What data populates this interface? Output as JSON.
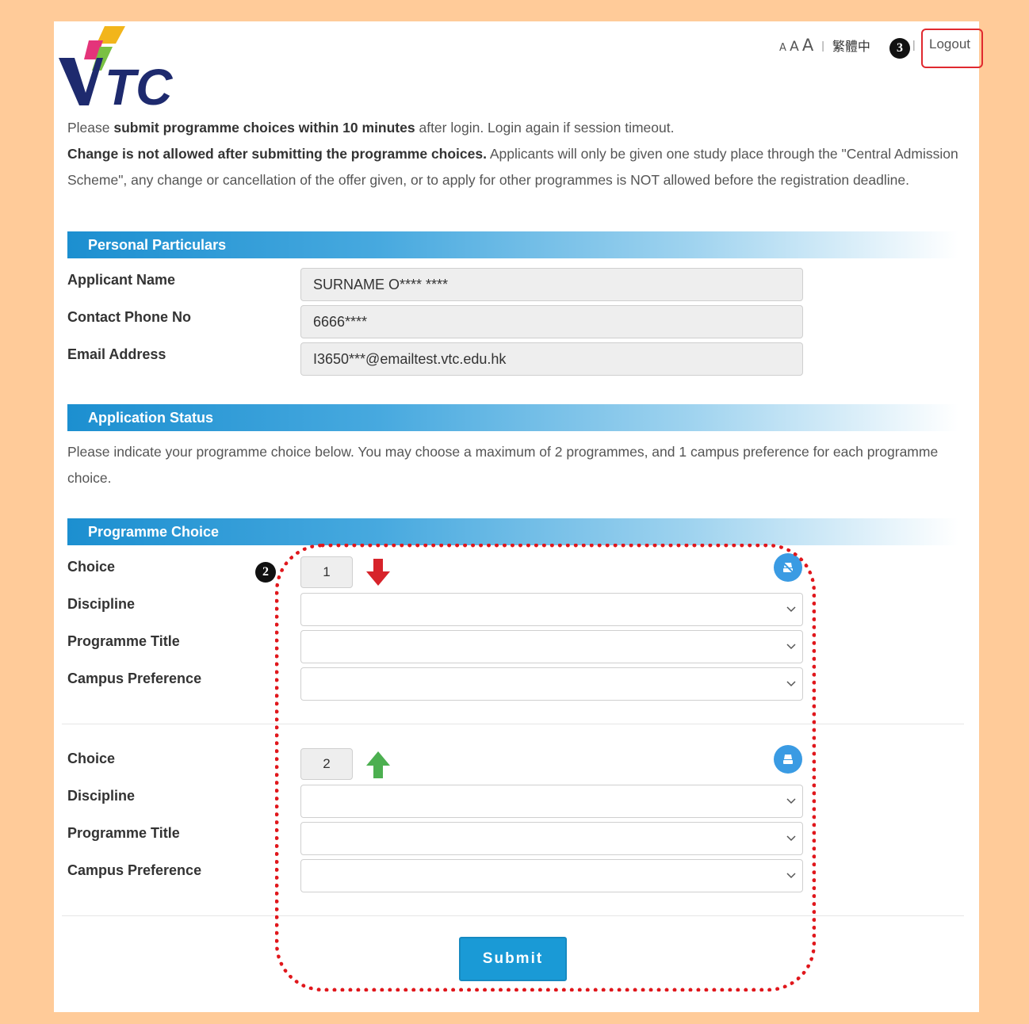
{
  "header": {
    "logo_alt": "VTC",
    "font_size_labels": [
      "A",
      "A",
      "A"
    ],
    "language_label": "繁體中",
    "logout_label": "Logout",
    "markers": {
      "logout": "3",
      "programme_area": "2"
    }
  },
  "intro": {
    "line1_prefix": "Please ",
    "line1_bold": "submit programme choices within 10 minutes",
    "line1_suffix": " after login. Login again if session timeout.",
    "line2_bold": "Change is not allowed after submitting the programme choices.",
    "line2_rest": " Applicants will only be given one study place through the \"Central Admission Scheme\", any change or cancellation of the offer given, or to apply for other programmes is NOT allowed before the registration deadline."
  },
  "personal": {
    "title": "Personal Particulars",
    "fields": [
      {
        "label": "Applicant Name",
        "value": "SURNAME O**** ****"
      },
      {
        "label": "Contact Phone No",
        "value": "6666****"
      },
      {
        "label": "Email Address",
        "value": "I3650***@emailtest.vtc.edu.hk"
      }
    ]
  },
  "status": {
    "title": "Application Status",
    "text": "Please indicate your programme choice below. You may choose a maximum of 2 programmes, and 1 campus preference for each programme choice."
  },
  "programme": {
    "title": "Programme Choice",
    "choices": [
      {
        "choice_label": "Choice",
        "number": "1",
        "arrow": "down-arrow-icon",
        "discipline_label": "Discipline",
        "programme_label": "Programme Title",
        "campus_label": "Campus Preference",
        "discipline_value": "",
        "programme_value": "",
        "campus_value": ""
      },
      {
        "choice_label": "Choice",
        "number": "2",
        "arrow": "up-arrow-icon",
        "discipline_label": "Discipline",
        "programme_label": "Programme Title",
        "campus_label": "Campus Preference",
        "discipline_value": "",
        "programme_value": "",
        "campus_value": ""
      }
    ],
    "submit_label": "Submit"
  },
  "colors": {
    "accent_blue": "#1a9ad6",
    "down_arrow": "#d7232a",
    "up_arrow": "#4caf50",
    "highlight_red": "#e0171c",
    "frame_background": "#ffcb99"
  }
}
